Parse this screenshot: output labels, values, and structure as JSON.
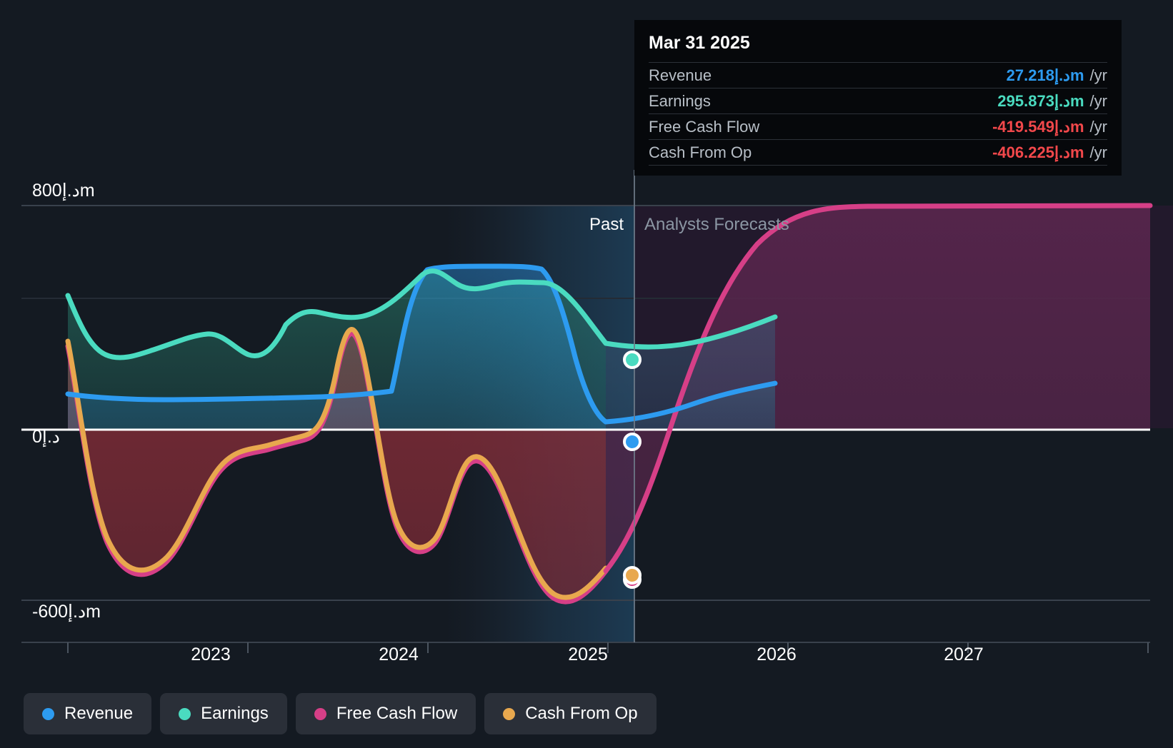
{
  "tooltip": {
    "date": "Mar 31 2025",
    "rows": [
      {
        "label": "Revenue",
        "value": "27.218د.إm",
        "unit": "/yr",
        "color": "#2d9bf0"
      },
      {
        "label": "Earnings",
        "value": "295.873د.إm",
        "unit": "/yr",
        "color": "#4adbc0"
      },
      {
        "label": "Free Cash Flow",
        "value": "-419.549د.إm",
        "unit": "/yr",
        "color": "#f2484b"
      },
      {
        "label": "Cash From Op",
        "value": "-406.225د.إm",
        "unit": "/yr",
        "color": "#f2484b"
      }
    ]
  },
  "chart_data": {
    "type": "area",
    "title": "",
    "xlabel": "",
    "ylabel": "",
    "currency": "د.إ",
    "unit_suffix": "m",
    "period": "/yr",
    "ylim": [
      -600,
      800
    ],
    "y_ticks": [
      800,
      0,
      -600
    ],
    "y_tick_labels": [
      "800د.إm",
      "0د.إ",
      "-600د.إm"
    ],
    "x_ticks": [
      "2023",
      "2024",
      "2025",
      "2026",
      "2027"
    ],
    "grid": true,
    "legend_position": "bottom",
    "divider": {
      "label_past": "Past",
      "label_forecast": "Analysts Forecasts",
      "at": "Mar 31 2025"
    },
    "series": [
      {
        "name": "Revenue",
        "color": "#2d9bf0",
        "marker_value": 27.218,
        "x": [
          2022.35,
          2022.6,
          2022.85,
          2023.1,
          2023.35,
          2023.6,
          2023.85,
          2024.1,
          2024.25,
          2024.5,
          2024.75,
          2024.9,
          2025.0,
          2025.25,
          2025.5,
          2026.0
        ],
        "values": [
          45,
          42,
          44,
          48,
          52,
          55,
          60,
          66,
          640,
          645,
          645,
          620,
          240,
          60,
          27.2,
          170
        ]
      },
      {
        "name": "Earnings",
        "color": "#4adbc0",
        "marker_value": 295.873,
        "x": [
          2022.35,
          2022.6,
          2022.85,
          2023.1,
          2023.35,
          2023.6,
          2023.85,
          2024.1,
          2024.35,
          2024.6,
          2024.85,
          2025.0,
          2025.25,
          2025.5,
          2026.0
        ],
        "values": [
          440,
          245,
          235,
          300,
          250,
          350,
          330,
          380,
          600,
          545,
          580,
          470,
          330,
          296,
          390
        ]
      },
      {
        "name": "Free Cash Flow",
        "color": "#d63f87",
        "marker_value": -419.549,
        "x": [
          2022.35,
          2022.6,
          2022.9,
          2023.2,
          2023.45,
          2023.7,
          2023.9,
          2024.15,
          2024.4,
          2024.7,
          2025.0,
          2025.2,
          2025.5,
          2025.9,
          2026.3,
          2026.8,
          2027.5
        ],
        "values": [
          290,
          -170,
          -455,
          -310,
          -215,
          -190,
          175,
          -330,
          -120,
          -420,
          -580,
          -420,
          -150,
          360,
          720,
          800,
          800
        ]
      },
      {
        "name": "Cash From Op",
        "color": "#e8a84e",
        "marker_value": -406.225,
        "x": [
          2022.35,
          2022.6,
          2022.9,
          2023.2,
          2023.45,
          2023.7,
          2023.9,
          2024.15,
          2024.4,
          2024.7,
          2025.0,
          2025.2,
          2025.5
        ],
        "values": [
          300,
          -160,
          -450,
          -300,
          -205,
          -180,
          185,
          -320,
          -110,
          -410,
          -570,
          -410,
          -406
        ]
      }
    ]
  },
  "legend": [
    {
      "label": "Revenue",
      "color": "#2d9bf0"
    },
    {
      "label": "Earnings",
      "color": "#4adbc0"
    },
    {
      "label": "Free Cash Flow",
      "color": "#d63f87"
    },
    {
      "label": "Cash From Op",
      "color": "#e8a84e"
    }
  ],
  "axis": {
    "y_top": "800د.إm",
    "y_zero": "0د.إ",
    "y_bottom": "-600د.إm",
    "years": [
      "2023",
      "2024",
      "2025",
      "2026",
      "2027"
    ]
  },
  "panel": {
    "past": "Past",
    "forecast": "Analysts Forecasts"
  }
}
